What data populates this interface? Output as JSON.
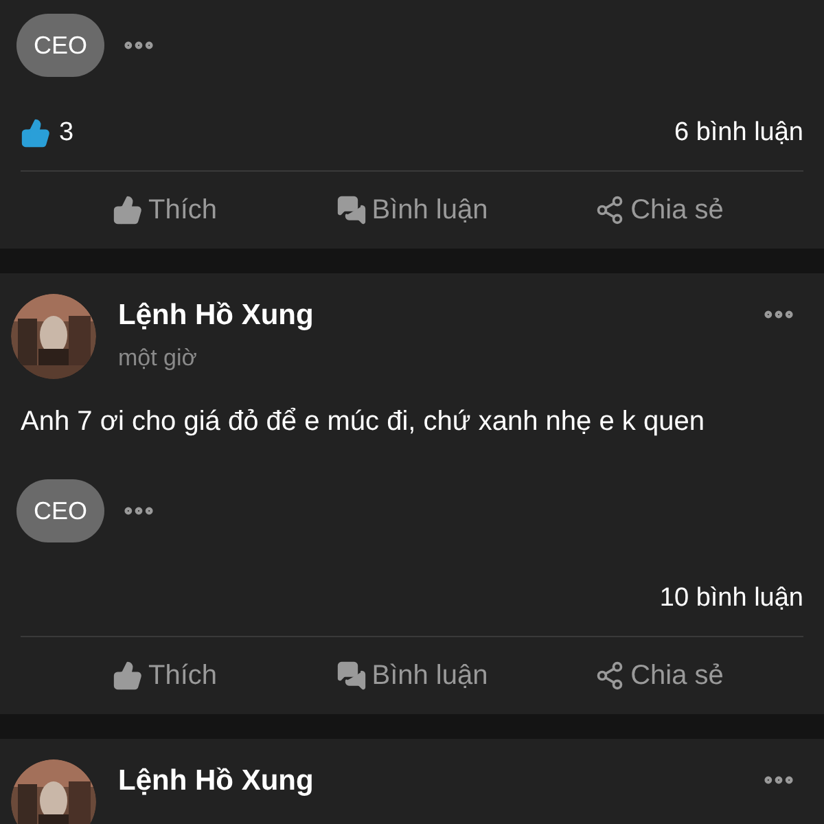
{
  "posts": [
    {
      "tags": [
        "CEO"
      ],
      "likes": "3",
      "comments": "6 bình luận",
      "actions": [
        {
          "kind": "like",
          "label": "Thích"
        },
        {
          "kind": "comment",
          "label": "Bình luận"
        },
        {
          "kind": "share",
          "label": "Chia sẻ"
        }
      ]
    },
    {
      "author": "Lệnh Hồ Xung",
      "time": "một giờ",
      "text": "Anh 7 ơi cho giá đỏ để e múc đi, chứ xanh nhẹ e k quen",
      "tags": [
        "CEO"
      ],
      "comments": "10 bình luận",
      "actions": [
        {
          "kind": "like",
          "label": "Thích"
        },
        {
          "kind": "comment",
          "label": "Bình luận"
        },
        {
          "kind": "share",
          "label": "Chia sẻ"
        }
      ]
    },
    {
      "author": "Lệnh Hồ Xung"
    }
  ]
}
